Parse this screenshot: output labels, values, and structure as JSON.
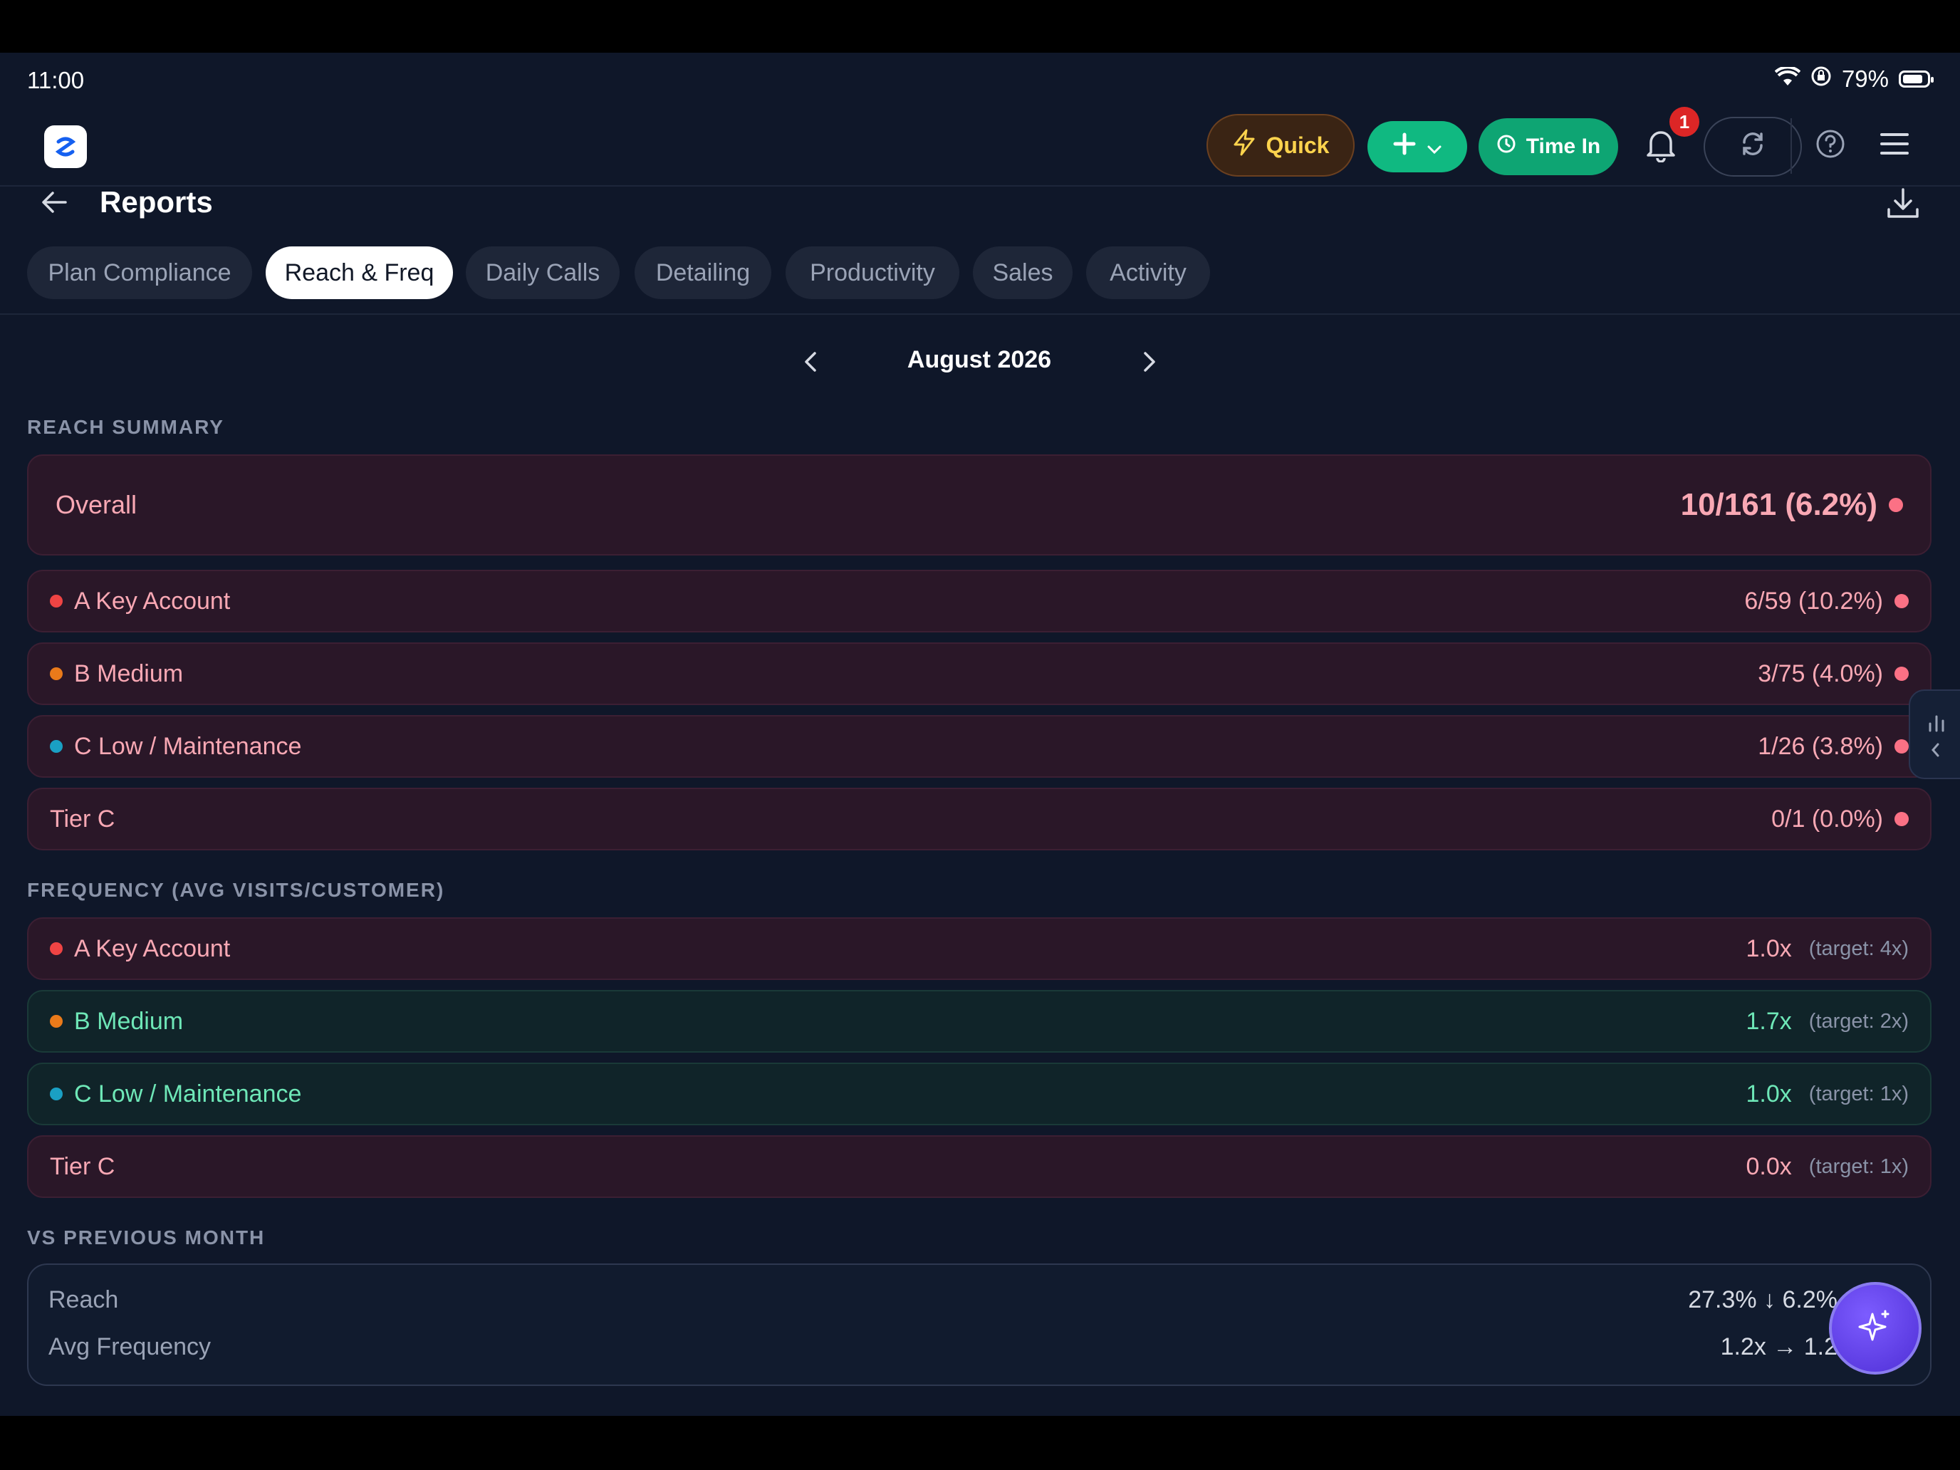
{
  "status_bar": {
    "time": "11:00",
    "battery": "79%"
  },
  "header": {
    "quick_label": "Quick",
    "time_in_label": "Time In",
    "notification_count": "1"
  },
  "page": {
    "title": "Reports"
  },
  "tabs": [
    {
      "label": "Plan Compliance",
      "active": false
    },
    {
      "label": "Reach & Freq",
      "active": true
    },
    {
      "label": "Daily Calls",
      "active": false
    },
    {
      "label": "Detailing",
      "active": false
    },
    {
      "label": "Productivity",
      "active": false
    },
    {
      "label": "Sales",
      "active": false
    },
    {
      "label": "Activity",
      "active": false
    }
  ],
  "month_nav": {
    "label": "August 2026"
  },
  "reach_summary": {
    "heading": "REACH SUMMARY",
    "overall": {
      "label": "Overall",
      "value": "10/161 (6.2%)"
    },
    "rows": [
      {
        "label": "A Key Account",
        "value": "6/59 (10.2%)",
        "dot": "red"
      },
      {
        "label": "B Medium",
        "value": "3/75 (4.0%)",
        "dot": "orange"
      },
      {
        "label": "C Low / Maintenance",
        "value": "1/26 (3.8%)",
        "dot": "teal"
      },
      {
        "label": "Tier C",
        "value": "0/1 (0.0%)",
        "dot": ""
      }
    ]
  },
  "frequency": {
    "heading": "FREQUENCY (AVG VISITS/CUSTOMER)",
    "rows": [
      {
        "label": "A Key Account",
        "value": "1.0x",
        "target": "(target: 4x)",
        "status": "red"
      },
      {
        "label": "B Medium",
        "value": "1.7x",
        "target": "(target: 2x)",
        "status": "green"
      },
      {
        "label": "C Low / Maintenance",
        "value": "1.0x",
        "target": "(target: 1x)",
        "status": "green"
      },
      {
        "label": "Tier C",
        "value": "0.0x",
        "target": "(target: 1x)",
        "status": "red"
      }
    ]
  },
  "vs_previous": {
    "heading": "VS PREVIOUS MONTH",
    "reach": {
      "label": "Reach",
      "value": "27.3% ↓ 6.2%"
    },
    "avg_frequency": {
      "label": "Avg Frequency",
      "value": "1.2x → 1.2"
    }
  },
  "colors": {
    "background": "#0f1729",
    "red_accent": "#f9a8b4",
    "green_accent": "#6ee7b7",
    "time_in_button": "#0ea573",
    "quick_text": "#fcd34d"
  }
}
